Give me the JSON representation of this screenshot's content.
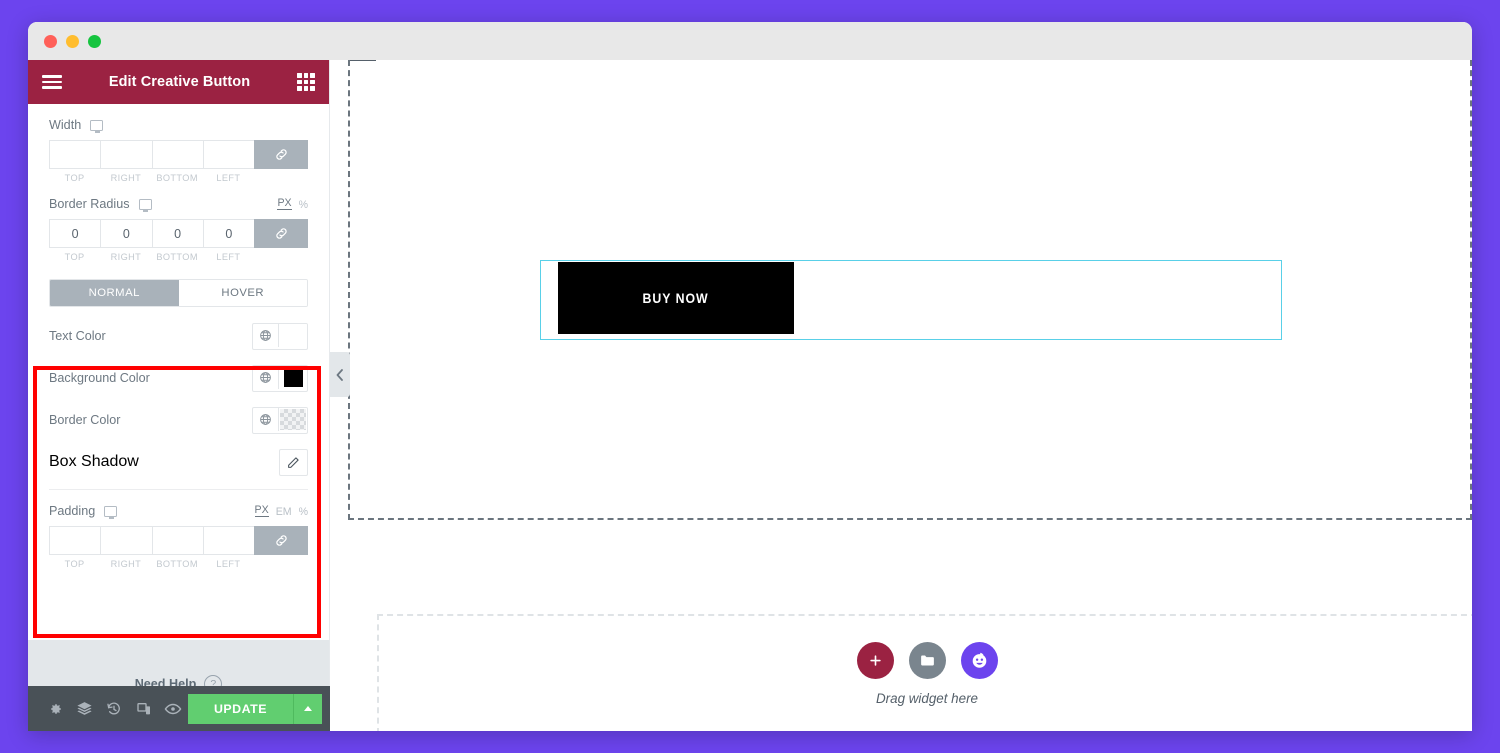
{
  "window": {
    "traffic_lights": [
      "close",
      "minimize",
      "maximize"
    ]
  },
  "panel": {
    "header": {
      "menu_icon": "hamburger-icon",
      "title": "Edit Creative Button",
      "grid_icon": "grid-apps-icon"
    },
    "controls": [
      {
        "type": "dimension",
        "label": "Width",
        "device_icon": "desktop-monitor-icon",
        "units": [],
        "values": [
          "",
          "",
          "",
          ""
        ],
        "sublabels": [
          "TOP",
          "RIGHT",
          "BOTTOM",
          "LEFT"
        ],
        "link_icon": "link-icon"
      },
      {
        "type": "dimension",
        "label": "Border Radius",
        "device_icon": "desktop-monitor-icon",
        "units": [
          {
            "label": "PX",
            "active": true
          },
          {
            "label": "%",
            "active": false
          }
        ],
        "values": [
          "0",
          "0",
          "0",
          "0"
        ],
        "sublabels": [
          "TOP",
          "RIGHT",
          "BOTTOM",
          "LEFT"
        ],
        "link_icon": "link-icon"
      }
    ],
    "tabs": [
      {
        "label": "NORMAL",
        "active": true
      },
      {
        "label": "HOVER",
        "active": false
      }
    ],
    "color_rows": [
      {
        "label": "Text Color",
        "swatch": "#ffffff",
        "transparent": false,
        "globe_icon": "globe-icon"
      },
      {
        "label": "Background Color",
        "swatch": "#000000",
        "transparent": false,
        "globe_icon": "globe-icon"
      },
      {
        "label": "Border Color",
        "swatch": "",
        "transparent": true,
        "globe_icon": "globe-icon"
      }
    ],
    "box_shadow": {
      "label": "Box Shadow",
      "edit_icon": "pencil-edit-icon"
    },
    "padding": {
      "label": "Padding",
      "device_icon": "desktop-monitor-icon",
      "units": [
        {
          "label": "PX",
          "active": true
        },
        {
          "label": "EM",
          "active": false
        },
        {
          "label": "%",
          "active": false
        }
      ],
      "values": [
        "",
        "",
        "",
        ""
      ],
      "sublabels": [
        "TOP",
        "RIGHT",
        "BOTTOM",
        "LEFT"
      ],
      "link_icon": "link-icon"
    },
    "need_help": {
      "label": "Need Help",
      "icon": "question-mark-icon"
    },
    "footer": {
      "icons": [
        "settings-gear-icon",
        "layers-navigator-icon",
        "history-revisions-icon",
        "responsive-mode-icon",
        "preview-eye-icon"
      ],
      "update_label": "UPDATE",
      "caret_icon": "caret-up-icon"
    },
    "collapse_icon": "chevron-left-icon"
  },
  "canvas": {
    "button_widget": {
      "label": "BUY NOW",
      "background": "#000000",
      "text_color": "#ffffff",
      "selection_border": "#59d0e8"
    },
    "drop_zone": {
      "buttons": [
        {
          "icon": "plus-icon",
          "color": "#9b2242"
        },
        {
          "icon": "folder-icon",
          "color": "#7a858e"
        },
        {
          "icon": "smiley-face-icon",
          "color": "#6c44ee"
        }
      ],
      "label": "Drag widget here"
    }
  },
  "annotation": {
    "color": "#ff0000",
    "name": "style-controls-highlight"
  }
}
